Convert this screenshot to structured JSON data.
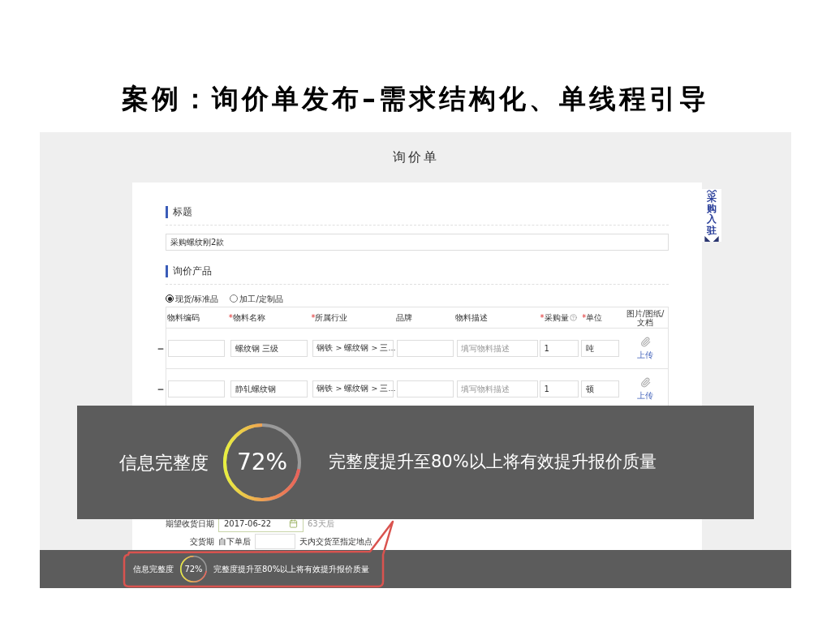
{
  "slide_title": "案例：询价单发布–需求结构化、单线程引导",
  "page_title": "询价单",
  "side_badge": {
    "text": "采购入驻"
  },
  "title_section": {
    "heading": "标题",
    "value": "采购螺纹刚2款"
  },
  "product_section": {
    "heading": "询价产品",
    "options": [
      {
        "label": "现货/标准品",
        "selected": true
      },
      {
        "label": "加工/定制品",
        "selected": false
      }
    ],
    "columns": [
      {
        "label": "物料编码",
        "required": false,
        "kind": "plain"
      },
      {
        "label": "物料名称",
        "required": true,
        "kind": "plain"
      },
      {
        "label": "所属行业",
        "required": true,
        "kind": "plain"
      },
      {
        "label": "品牌",
        "required": false,
        "kind": "plain"
      },
      {
        "label": "物料描述",
        "required": false,
        "kind": "plain"
      },
      {
        "label": "采购量",
        "required": true,
        "kind": "help"
      },
      {
        "label": "单位",
        "required": true,
        "kind": "plain"
      },
      {
        "label": "图片/图纸/文档",
        "required": false,
        "kind": "plain"
      }
    ],
    "required_mark": "*",
    "rows": [
      {
        "name": "螺纹钢 三级",
        "industry": "钢铁 > 螺纹钢 > 三...",
        "description_placeholder": "填写物料描述",
        "quantity": "1",
        "unit": "吨",
        "upload": "上传"
      },
      {
        "name": "静轧螺纹钢",
        "industry": "钢铁 > 螺纹钢 > 三...",
        "description_placeholder": "填写物料描述",
        "quantity": "1",
        "unit": "顿",
        "upload": "上传"
      }
    ]
  },
  "delivery_date": {
    "label": "期望收货日期",
    "value": "2017-06-22",
    "note": "63天后"
  },
  "delivery_period": {
    "label": "交货期",
    "prefix": "自下单后",
    "suffix": "天内交货至指定地点"
  },
  "overlay": {
    "label": "信息完整度",
    "percent": "72%",
    "message": "完整度提升至80%以上将有效提升报价质量"
  },
  "bottom_bar": {
    "label": "信息完整度",
    "percent": "72%",
    "message": "完整度提升至80%以上将有效提升报价质量"
  }
}
